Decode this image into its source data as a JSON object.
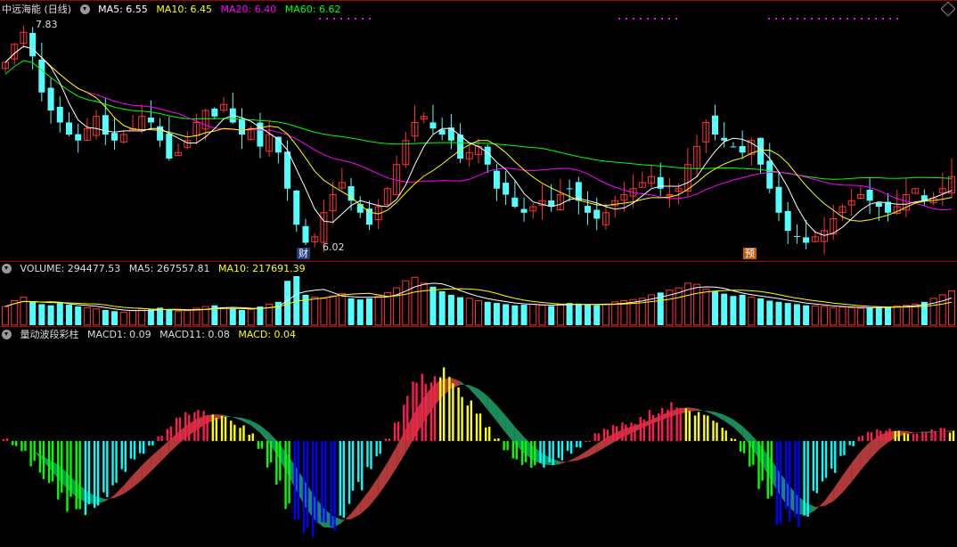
{
  "price_panel": {
    "title": "中远海能 (日线)",
    "ma5_label": "MA5: 6.55",
    "ma10_label": "MA10: 6.45",
    "ma20_label": "MA20: 6.40",
    "ma60_label": "MA60: 6.62",
    "high_label": "7.83",
    "low_label": "6.02",
    "badge_cai": "财",
    "badge_yu": "预"
  },
  "volume_panel": {
    "volume_label": "VOLUME: 294477.53",
    "ma5_label": "MA5: 267557.81",
    "ma10_label": "MA10: 217691.39"
  },
  "macd_panel": {
    "title": "量动波段彩柱",
    "macd1_label": "MACD1: 0.09",
    "macd11_label": "MACD11: 0.08",
    "macd_label": "MACD: 0.04"
  },
  "colors": {
    "up": "#ff3232",
    "down": "#54ffff",
    "ma5": "#ffffff",
    "ma10": "#ffff00",
    "ma20": "#ff00ff",
    "ma60": "#00ff00",
    "macd_red": "#ff1a50",
    "macd_yellow": "#ffff00",
    "macd_green": "#00ff00",
    "macd_cyan": "#00ffff",
    "macd_blue": "#0000ff"
  },
  "chart_data": {
    "type": "candlestick",
    "price_range": [
      5.95,
      7.95
    ],
    "close": [
      7.55,
      7.7,
      7.8,
      7.6,
      7.3,
      7.15,
      7.05,
      6.95,
      6.9,
      7.0,
      7.1,
      6.95,
      6.9,
      6.95,
      7.0,
      7.1,
      7.05,
      6.9,
      6.75,
      6.8,
      6.9,
      7.05,
      7.15,
      7.1,
      7.2,
      7.05,
      6.95,
      7.0,
      6.85,
      6.95,
      6.8,
      6.5,
      6.2,
      6.05,
      6.1,
      6.3,
      6.45,
      6.55,
      6.4,
      6.3,
      6.2,
      6.35,
      6.5,
      6.7,
      6.9,
      7.05,
      7.1,
      7.0,
      6.95,
      6.9,
      6.75,
      6.8,
      6.85,
      6.7,
      6.5,
      6.45,
      6.35,
      6.3,
      6.35,
      6.4,
      6.35,
      6.45,
      6.5,
      6.4,
      6.3,
      6.25,
      6.3,
      6.4,
      6.45,
      6.5,
      6.55,
      6.6,
      6.5,
      6.45,
      6.5,
      6.7,
      6.85,
      7.05,
      6.95,
      6.9,
      6.85,
      6.8,
      6.9,
      6.7,
      6.5,
      6.3,
      6.15,
      6.1,
      6.05,
      6.1,
      6.15,
      6.25,
      6.35,
      6.4,
      6.45,
      6.4,
      6.35,
      6.3,
      6.35,
      6.45,
      6.5,
      6.4,
      6.42,
      6.5,
      6.6
    ],
    "volume_max": 420000,
    "volume": [
      160000,
      210000,
      240000,
      200000,
      180000,
      170000,
      190000,
      175000,
      160000,
      150000,
      140000,
      130000,
      120000,
      110000,
      125000,
      140000,
      135000,
      150000,
      130000,
      120000,
      125000,
      145000,
      160000,
      170000,
      150000,
      140000,
      130000,
      135000,
      160000,
      180000,
      200000,
      380000,
      420000,
      260000,
      240000,
      230000,
      250000,
      270000,
      230000,
      220000,
      230000,
      250000,
      280000,
      320000,
      380000,
      410000,
      360000,
      330000,
      290000,
      260000,
      240000,
      230000,
      210000,
      200000,
      190000,
      180000,
      170000,
      175000,
      180000,
      170000,
      165000,
      175000,
      190000,
      185000,
      175000,
      170000,
      180000,
      200000,
      210000,
      220000,
      230000,
      260000,
      280000,
      300000,
      320000,
      360000,
      350000,
      310000,
      290000,
      270000,
      250000,
      260000,
      240000,
      230000,
      210000,
      200000,
      190000,
      180000,
      170000,
      165000,
      160000,
      150000,
      155000,
      150000,
      145000,
      150000,
      155000,
      160000,
      165000,
      170000,
      180000,
      200000,
      230000,
      260000,
      294478
    ],
    "macd": [
      0.01,
      -0.02,
      -0.05,
      -0.1,
      -0.15,
      -0.2,
      -0.24,
      -0.27,
      -0.28,
      -0.28,
      -0.26,
      -0.22,
      -0.17,
      -0.12,
      -0.08,
      -0.05,
      -0.02,
      0.02,
      0.06,
      0.09,
      0.11,
      0.12,
      0.12,
      0.11,
      0.1,
      0.08,
      0.06,
      0.03,
      -0.03,
      -0.1,
      -0.18,
      -0.26,
      -0.33,
      -0.38,
      -0.4,
      -0.38,
      -0.34,
      -0.29,
      -0.24,
      -0.19,
      -0.13,
      -0.06,
      0.01,
      0.09,
      0.17,
      0.23,
      0.27,
      0.29,
      0.28,
      0.25,
      0.21,
      0.16,
      0.11,
      0.06,
      0.01,
      -0.04,
      -0.08,
      -0.1,
      -0.11,
      -0.11,
      -0.1,
      -0.08,
      -0.05,
      -0.03,
      0.0,
      0.03,
      0.05,
      0.06,
      0.07,
      0.08,
      0.1,
      0.12,
      0.14,
      0.15,
      0.15,
      0.14,
      0.12,
      0.1,
      0.08,
      0.05,
      0.01,
      -0.05,
      -0.12,
      -0.2,
      -0.27,
      -0.32,
      -0.34,
      -0.33,
      -0.29,
      -0.24,
      -0.18,
      -0.12,
      -0.06,
      -0.02,
      0.02,
      0.04,
      0.05,
      0.05,
      0.04,
      0.03,
      0.03,
      0.04,
      0.05,
      0.05,
      0.04
    ]
  }
}
